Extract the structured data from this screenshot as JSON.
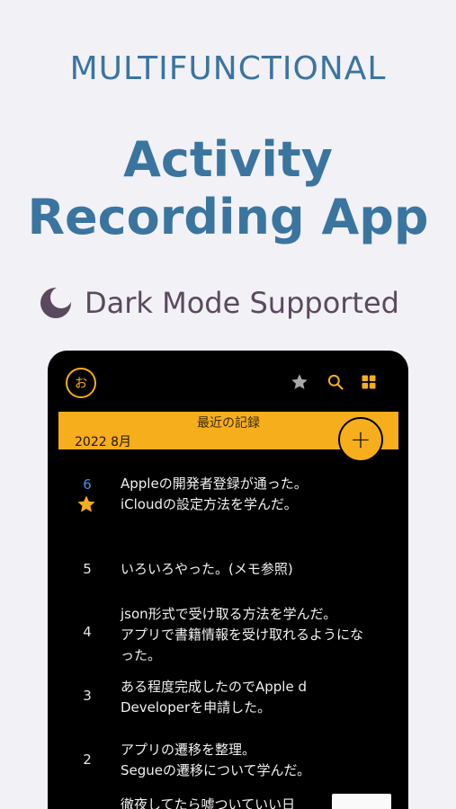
{
  "promo": {
    "eyebrow": "MULTIFUNCTIONAL",
    "title_line1": "Activity",
    "title_line2": "Recording App",
    "feature": "Dark Mode Supported",
    "feature_icon": "moon-icon",
    "colors": {
      "title": "#3a75a0",
      "feature": "#5a4a5e",
      "background": "#f2f1f6"
    }
  },
  "app": {
    "avatar_label": "お",
    "toolbar_icons": [
      "star-icon",
      "search-icon",
      "grid-icon"
    ],
    "accent": "#f6ae1c",
    "banner": {
      "title": "最近の記録",
      "date": "2022 8月"
    },
    "add_label": "+",
    "entries": [
      {
        "day": "6",
        "starred": true,
        "lines": [
          "Appleの開発者登録が通った。",
          "iCloudの設定方法を学んだ。"
        ]
      },
      {
        "day": "5",
        "starred": false,
        "lines": [
          "いろいろやった。(メモ参照)"
        ]
      },
      {
        "day": "4",
        "starred": false,
        "lines": [
          "json形式で受け取る方法を学んだ。",
          "アプリで書籍情報を受け取れるようにな",
          "った。"
        ]
      },
      {
        "day": "3",
        "starred": false,
        "lines": [
          "ある程度完成したのでApple d",
          "Developerを申請した。"
        ]
      },
      {
        "day": "2",
        "starred": false,
        "lines": [
          "アプリの遷移を整理。",
          "Segueの遷移について学んだ。"
        ]
      },
      {
        "day": "",
        "starred": false,
        "lines": [
          "徹夜してたら嘘ついていい日"
        ]
      }
    ]
  }
}
